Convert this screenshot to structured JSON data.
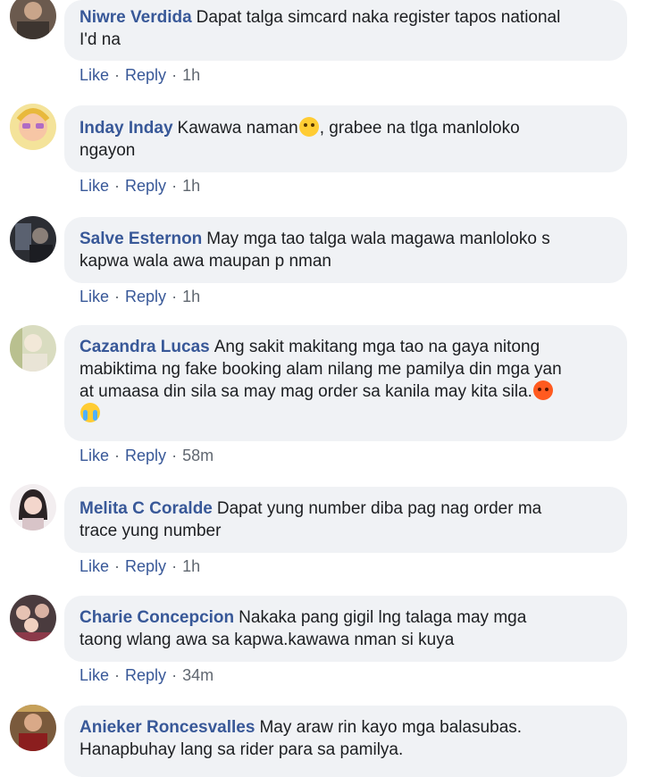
{
  "actions": {
    "like": "Like",
    "reply": "Reply",
    "separator": "·"
  },
  "comments": [
    {
      "author": "Niwre Verdida",
      "text_lines": [
        "Dapat talga simcard naka register tapos national",
        "I'd na"
      ],
      "time": "1h"
    },
    {
      "author": "Inday Inday",
      "text_a": "Kawawa naman",
      "text_b": ", grabee na tlga manloloko",
      "text_line2": "ngayon",
      "emoji": "crying-face-icon",
      "time": "1h"
    },
    {
      "author": "Salve Esternon",
      "text_lines": [
        "May mga tao talga wala magawa manloloko s",
        "kapwa wala awa maupan p nman"
      ],
      "time": "1h"
    },
    {
      "author": "Cazandra Lucas",
      "text_lines": [
        "Ang sakit makitang mga tao na gaya nitong",
        "mabiktima ng fake booking alam nilang me pamilya din mga yan",
        "at umaasa din sila sa may mag order sa kanila may kita sila."
      ],
      "emojis": [
        "angry-face-icon",
        "loudly-crying-face-icon"
      ],
      "time": "58m"
    },
    {
      "author": "Melita C Coralde",
      "text_lines": [
        "Dapat yung number diba pag nag order ma",
        "trace yung number"
      ],
      "time": "1h"
    },
    {
      "author": "Charie Concepcion",
      "text_lines": [
        "Nakaka pang gigil lng talaga may mga",
        "taong wlang awa sa kapwa.kawawa nman si kuya"
      ],
      "time": "34m"
    },
    {
      "author": "Anieker Roncesvalles",
      "text_lines": [
        "May araw rin kayo mga balasubas.",
        "Hanapbuhay lang sa rider para sa pamilya."
      ]
    }
  ]
}
